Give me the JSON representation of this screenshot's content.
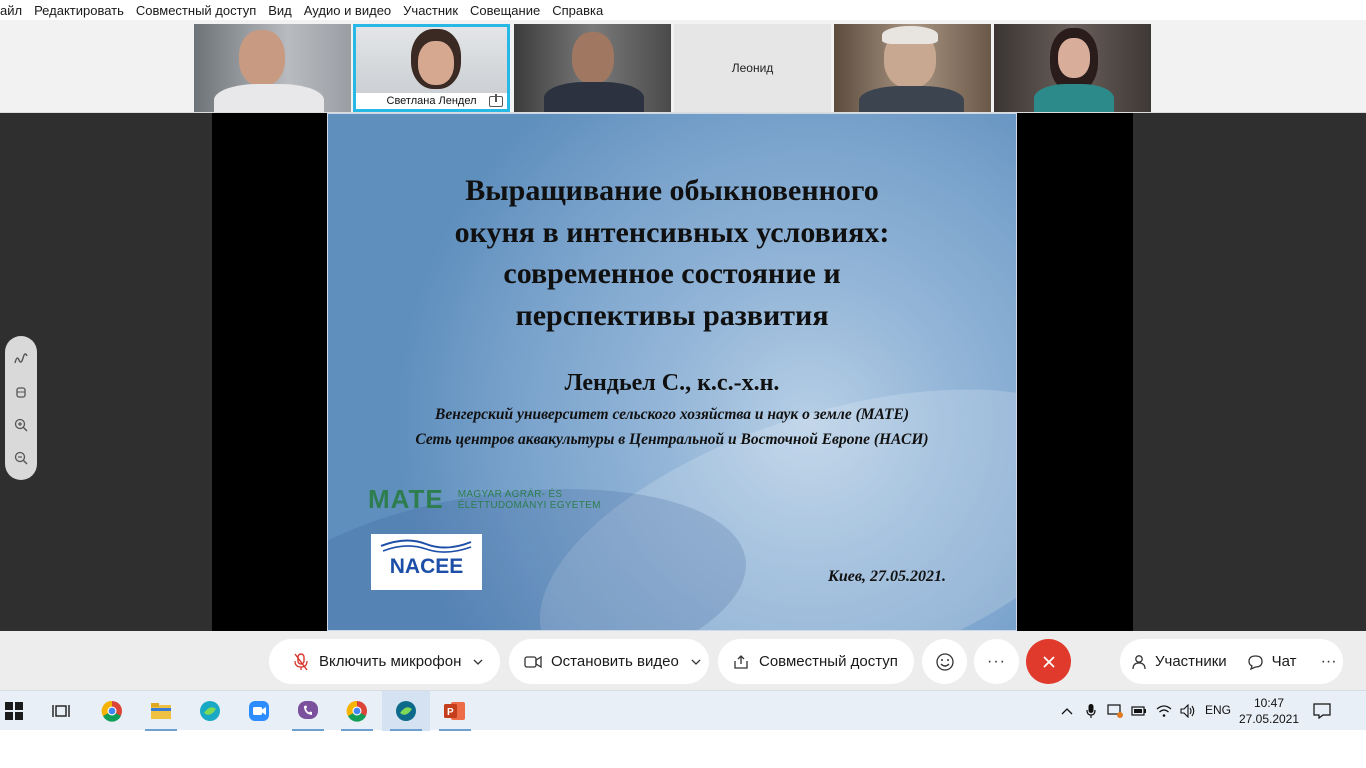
{
  "menu": {
    "items": [
      "айл",
      "Редактировать",
      "Совместный доступ",
      "Вид",
      "Аудио и видео",
      "Участник",
      "Совещание",
      "Справка"
    ]
  },
  "participants": [
    {
      "name": "",
      "active": false
    },
    {
      "name": "Светлана Лендел",
      "active": true
    },
    {
      "name": "",
      "active": false
    },
    {
      "name": "Леонид",
      "active": false
    },
    {
      "name": "",
      "active": false
    },
    {
      "name": "",
      "active": false
    }
  ],
  "slide": {
    "title_lines": [
      "Выращивание обыкновенного",
      "окуня в интенсивных условиях:",
      "современное состояние и",
      "перспективы развития"
    ],
    "author": "Лендьел С., к.с.-х.н.",
    "affiliation_1": "Венгерский университет сельского хозяйства и наук о земле (MATE)",
    "affiliation_2": "Сеть центров аквакультуры в Центральной и Восточной Европе (НАСИ)",
    "mate_mark": "MATE",
    "mate_text_1": "MAGYAR AGRÁR- ÉS",
    "mate_text_2": "ÉLETTUDOMÁNYI EGYETEM",
    "nacee": "NACEE",
    "date": "Киев, 27.05.2021."
  },
  "side_tools": [
    "annotate-icon",
    "eraser-icon",
    "zoom-in-icon",
    "zoom-out-icon"
  ],
  "controls": {
    "mic_label": "Включить микрофон",
    "video_label": "Остановить видео",
    "share_label": "Совместный доступ",
    "participants_label": "Участники",
    "chat_label": "Чат",
    "more_glyph": "···"
  },
  "taskbar": {
    "apps": [
      "start",
      "task-view",
      "chrome",
      "file-explorer",
      "webex",
      "zoom",
      "viber",
      "chrome",
      "webex-meetings",
      "powerpoint"
    ],
    "lang": "ENG",
    "time": "10:47",
    "date": "27.05.2021"
  },
  "colors": {
    "accent_border": "#28b8e6",
    "end_call": "#e03a2c",
    "stage_bg": "#2f2f2f",
    "mate_green": "#2e7d4f",
    "nacee_blue": "#1d4fa8"
  }
}
